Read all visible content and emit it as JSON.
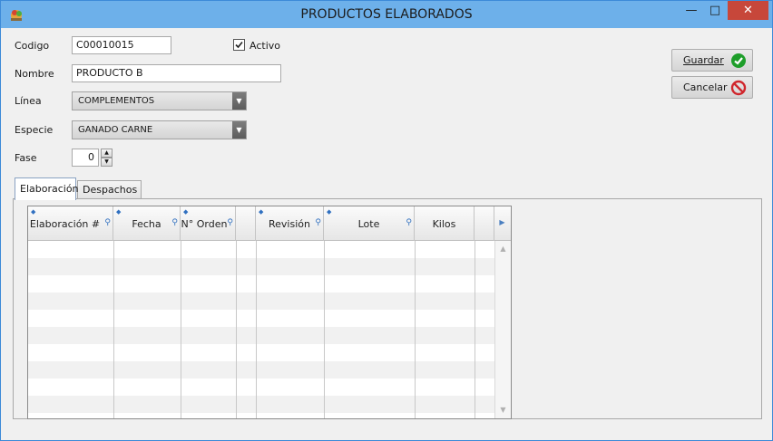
{
  "window": {
    "title": "PRODUCTOS ELABORADOS",
    "minimize": "—",
    "maximize": "□",
    "close": "✕"
  },
  "form": {
    "codigo_label": "Codigo",
    "codigo_value": "C00010015",
    "activo_label": "Activo",
    "activo_checked": true,
    "nombre_label": "Nombre",
    "nombre_value": "PRODUCTO B",
    "linea_label": "Línea",
    "linea_value": "COMPLEMENTOS",
    "especie_label": "Especie",
    "especie_value": "GANADO CARNE",
    "fase_label": "Fase",
    "fase_value": "0"
  },
  "buttons": {
    "guardar": "Guardar",
    "cancelar": "Cancelar"
  },
  "tabs": [
    {
      "label": "Elaboración",
      "active": true
    },
    {
      "label": "Despachos",
      "active": false
    }
  ],
  "grid": {
    "columns": [
      "Elaboración #",
      "Fecha",
      "N° Orden",
      "",
      "Revisión",
      "Lote",
      "Kilos",
      ""
    ],
    "rows": []
  },
  "colors": {
    "titlebar": "#6db0ea",
    "close_button": "#c7473a",
    "guardar_icon": "#1e9e2a",
    "cancelar_icon": "#d0262c"
  }
}
